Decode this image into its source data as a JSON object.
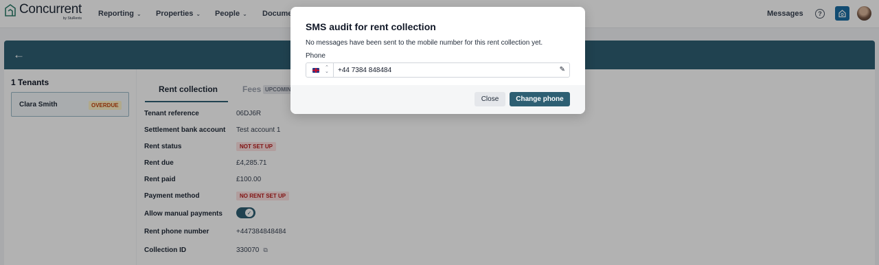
{
  "app": {
    "logo_text": "Concurrent",
    "logo_subtext": "by StuRents"
  },
  "nav": {
    "items": [
      {
        "label": "Reporting"
      },
      {
        "label": "Properties"
      },
      {
        "label": "People"
      },
      {
        "label": "Documents"
      }
    ],
    "messages_label": "Messages",
    "help_symbol": "?"
  },
  "icons": {
    "back": "back-arrow-icon",
    "help": "help-circle-icon",
    "home": "home-icon",
    "edit": "pencil-icon",
    "copy": "copy-icon",
    "check": "check-icon"
  },
  "colors": {
    "brand": "#2e5f73",
    "primary_button": "#2e5f73",
    "overdue": "#c2410c",
    "warning_red": "#b91c1c"
  },
  "sidebar": {
    "title": "1 Tenants",
    "tenants": [
      {
        "name": "Clara Smith",
        "status": "OVERDUE"
      }
    ]
  },
  "tabs": [
    {
      "label": "Rent collection",
      "active": true
    },
    {
      "label": "Fees",
      "badge": "UPCOMING",
      "active": false
    }
  ],
  "details": {
    "tenant_reference": {
      "label": "Tenant reference",
      "value": "06DJ6R"
    },
    "settlement_account": {
      "label": "Settlement bank account",
      "value": "Test account 1"
    },
    "rent_status": {
      "label": "Rent status",
      "value": "NOT SET UP"
    },
    "rent_due": {
      "label": "Rent due",
      "value": "£4,285.71"
    },
    "rent_paid": {
      "label": "Rent paid",
      "value": "£100.00"
    },
    "payment_method": {
      "label": "Payment method",
      "value": "NO RENT SET UP"
    },
    "allow_manual_payments": {
      "label": "Allow manual payments",
      "enabled": true
    },
    "rent_phone": {
      "label": "Rent phone number",
      "value": "+447384848484"
    },
    "collection_id": {
      "label": "Collection ID",
      "value": "330070"
    }
  },
  "modal": {
    "title": "SMS audit for rent collection",
    "message": "No messages have been sent to the mobile number for this rent collection yet.",
    "phone_label": "Phone",
    "phone_value": "+44 7384 848484",
    "country": "GB",
    "close_label": "Close",
    "change_label": "Change phone"
  }
}
